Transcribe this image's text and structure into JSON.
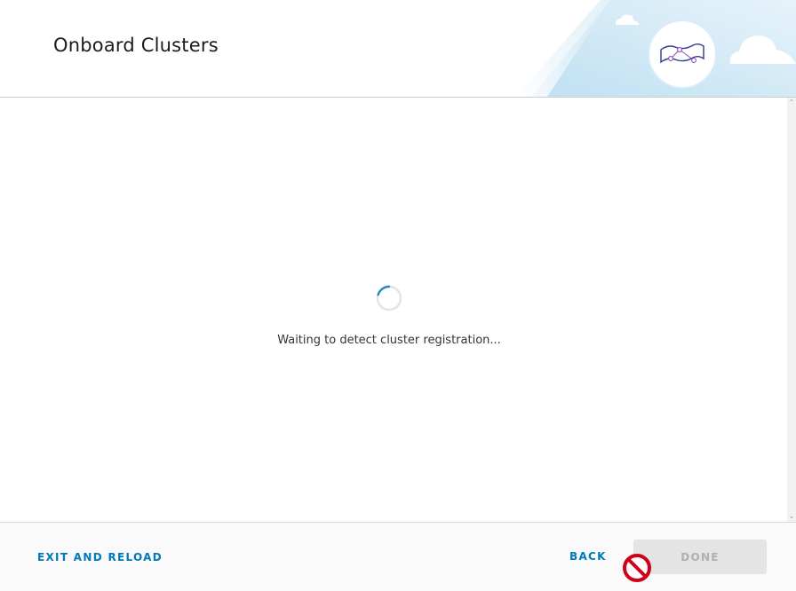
{
  "dialog": {
    "title": "Onboard Clusters"
  },
  "header": {
    "illustration_icon": "cluster-network-icon",
    "decor_icons": [
      "cloud-icon",
      "cloud-icon"
    ]
  },
  "status": {
    "message": "Waiting to detect cluster registration...",
    "spinner_icon": "loading-spinner-icon"
  },
  "footer": {
    "exit_label": "EXIT AND RELOAD",
    "back_label": "BACK",
    "done_label": "DONE"
  },
  "cursor": {
    "icon": "not-allowed-cursor-icon"
  },
  "colors": {
    "accent": "#0079b8",
    "spinner": "#1e8bc3",
    "disabled_bg": "#e4e4e4",
    "disabled_text": "#b0b0b0",
    "cursor_red": "#d0021b"
  }
}
